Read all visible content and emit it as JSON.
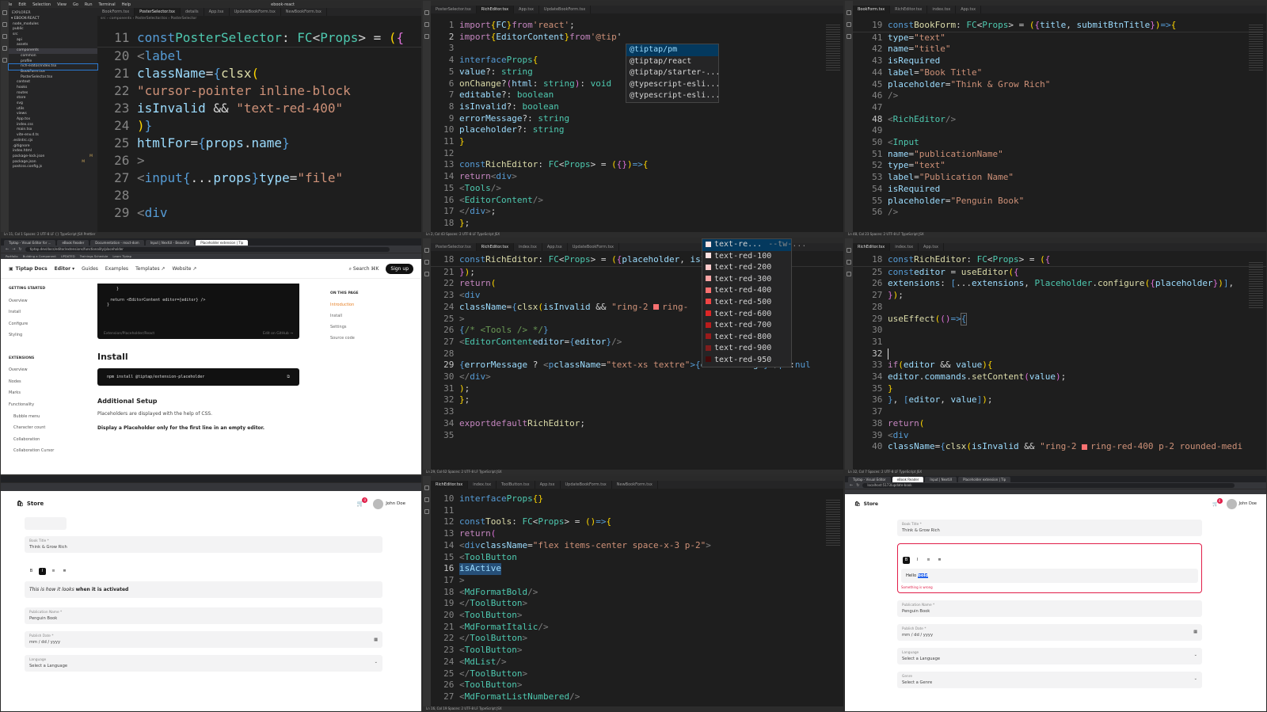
{
  "p1": {
    "menu": [
      "File",
      "Edit",
      "Selection",
      "View",
      "Go",
      "Run",
      "Terminal",
      "Help"
    ],
    "tabs": [
      "BookForm.tsx",
      "PosterSelector.tsx",
      "details",
      "App.tsx",
      "UpdateBookForm.tsx",
      "NewBookForm.tsx"
    ],
    "active_tab": "PosterSelector.tsx",
    "title": "ebook-react",
    "breadcrumb": "src › components › PosterSelector.tsx › PosterSelector",
    "explorer_title": "EXPLORER",
    "project": "EBOOK-REACT",
    "tree": [
      {
        "label": "node_modules",
        "depth": 1
      },
      {
        "label": "public",
        "depth": 1
      },
      {
        "label": "src",
        "depth": 1
      },
      {
        "label": "api",
        "depth": 2
      },
      {
        "label": "assets",
        "depth": 2
      },
      {
        "label": "components",
        "depth": 2,
        "sel": true
      },
      {
        "label": "common",
        "depth": 3
      },
      {
        "label": "profile",
        "depth": 3
      },
      {
        "label": "rich-editor/index.tsx",
        "depth": 3,
        "foc": true
      },
      {
        "label": "BookForm.tsx",
        "depth": 3
      },
      {
        "label": "PosterSelector.tsx",
        "depth": 3
      },
      {
        "label": "context",
        "depth": 2
      },
      {
        "label": "hooks",
        "depth": 2
      },
      {
        "label": "routes",
        "depth": 2
      },
      {
        "label": "store",
        "depth": 2
      },
      {
        "label": "svg",
        "depth": 2
      },
      {
        "label": "utils",
        "depth": 2
      },
      {
        "label": "views",
        "depth": 2
      },
      {
        "label": "App.tsx",
        "depth": 2
      },
      {
        "label": "index.css",
        "depth": 2
      },
      {
        "label": "main.tsx",
        "depth": 2
      },
      {
        "label": "vite-env.d.ts",
        "depth": 2
      },
      {
        "label": ".eslintrc.cjs",
        "depth": 1
      },
      {
        "label": ".gitignore",
        "depth": 1
      },
      {
        "label": "index.html",
        "depth": 1
      },
      {
        "label": "package-lock.json",
        "depth": 1,
        "m": "M"
      },
      {
        "label": "package.json",
        "depth": 1,
        "m": "M"
      },
      {
        "label": "postcss.config.js",
        "depth": 1
      }
    ],
    "status": "Ln 11, Col 1   Spaces: 2   UTF-8   LF   {} TypeScript JSX   Prettier"
  },
  "p2": {
    "tabs": [
      "PosterSelector.tsx",
      "RichEditor.tsx",
      "App.tsx",
      "UpdateBookForm.tsx"
    ],
    "active_tab": "RichEditor.tsx",
    "suggestions": [
      {
        "label": "@tiptap/pm"
      },
      {
        "label": "@tiptap/react"
      },
      {
        "label": "@tiptap/starter-..."
      },
      {
        "label": "@typescript-esli..."
      },
      {
        "label": "@typescript-esli..."
      }
    ],
    "status": "Ln 2, Col 43   Spaces: 2   UTF-8   LF   TypeScript JSX"
  },
  "p3": {
    "tabs": [
      "BookForm.tsx",
      "RichEditor.tsx",
      "index.tsx",
      "App.tsx"
    ],
    "active_tab": "BookForm.tsx",
    "status": "Ln 48, Col 23   Spaces: 2   UTF-8   LF   TypeScript JSX"
  },
  "p4": {
    "tabs": [
      "Tiptap - Visual Editor for ...",
      "eBook Reader",
      "Documentation - react-dom",
      "Input | NextUI - Beautiful",
      "Placeholder extension | Tip"
    ],
    "url": "tiptap.dev/docs/editor/extensions/functionality/placeholder",
    "bookmarks": [
      "Portfolio",
      "Building a Component",
      "UPDATED",
      "Trainings Schedule",
      "Learn Tiptap"
    ],
    "brand": "Tiptap Docs",
    "nav": [
      "Editor ▾",
      "Guides",
      "Examples",
      "Templates ↗",
      "Website ↗"
    ],
    "search": "Search  ⌘K",
    "signup": "Sign up",
    "sidebar": [
      {
        "label": "GETTING STARTED",
        "h": true
      },
      {
        "label": "Overview"
      },
      {
        "label": "Install"
      },
      {
        "label": "Configure"
      },
      {
        "label": "Styling"
      },
      {
        "label": ""
      },
      {
        "label": "EXTENSIONS",
        "h": true
      },
      {
        "label": "Overview"
      },
      {
        "label": "Nodes"
      },
      {
        "label": "Marks"
      },
      {
        "label": "Functionality"
      },
      {
        "label": "Bubble menu",
        "sub": true
      },
      {
        "label": "Character count",
        "sub": true
      },
      {
        "label": "Collaboration",
        "sub": true
      },
      {
        "label": "Collaboration Cursor",
        "sub": true
      }
    ],
    "snippet_brace": "}",
    "snippet_return": "return <EditorContent editor={editor} />",
    "snippet_close": "}",
    "snippet_source": "Extension/Placeholder/React",
    "snippet_edit": "Edit on GitHub →",
    "install_heading": "Install",
    "install_cmd": "npm install @tiptap/extension-placeholder",
    "setup_heading": "Additional Setup",
    "setup_text": "Placeholders are displayed with the help of CSS.",
    "setup_bold": "Display a Placeholder only for the first line in an empty editor.",
    "on_this_page": "ON THIS PAGE",
    "toc": [
      "Introduction",
      "Install",
      "Settings",
      "Source code"
    ]
  },
  "p5": {
    "tabs": [
      "PosterSelector.tsx",
      "RichEditor.tsx",
      "index.tsx",
      "App.tsx",
      "UpdateBookForm.tsx"
    ],
    "active_tab": "RichEditor.tsx",
    "colors": [
      {
        "label": "text-re...",
        "swatch": "#fee2e2",
        "extra": "--tw-..."
      },
      {
        "label": "text-red-100",
        "swatch": "#fee2e2"
      },
      {
        "label": "text-red-200",
        "swatch": "#fecaca"
      },
      {
        "label": "text-red-300",
        "swatch": "#fca5a5"
      },
      {
        "label": "text-red-400",
        "swatch": "#f87171"
      },
      {
        "label": "text-red-500",
        "swatch": "#ef4444"
      },
      {
        "label": "text-red-600",
        "swatch": "#dc2626"
      },
      {
        "label": "text-red-700",
        "swatch": "#b91c1c"
      },
      {
        "label": "text-red-800",
        "swatch": "#991b1b"
      },
      {
        "label": "text-red-900",
        "swatch": "#7f1d1d"
      },
      {
        "label": "text-red-950",
        "swatch": "#450a0a"
      }
    ],
    "status": "Ln 29, Col 62   Spaces: 2   UTF-8   LF   TypeScript JSX"
  },
  "p6": {
    "tabs": [
      "RichEditor.tsx",
      "index.tsx",
      "App.tsx"
    ],
    "status": "Ln 32, Col 7   Spaces: 2   UTF-8   LF   TypeScript JSX"
  },
  "p7": {
    "store_title": "Store",
    "cart_count": "0",
    "user": "John Doe",
    "book_title_label": "Book Title *",
    "book_title_value": "Think & Grow Rich",
    "toolbar": [
      "B",
      "I",
      "≡",
      "≣"
    ],
    "editor_italic": "This is how it looks",
    "editor_bold": "when it is activated",
    "publication_label": "Publication Name *",
    "publication_value": "Penguin Book",
    "publish_label": "Publish Date *",
    "publish_value": "mm / dd / yyyy",
    "language_label": "Language",
    "language_value": "Select a Language"
  },
  "p8": {
    "tabs": [
      "RichEditor.tsx",
      "index.tsx",
      "ToolButton.tsx",
      "App.tsx",
      "UpdateBookForm.tsx",
      "NewBookForm.tsx"
    ],
    "active_tab": "RichEditor.tsx",
    "status": "Ln 16, Col 19   Spaces: 2   UTF-8   LF   TypeScript JSX"
  },
  "p9": {
    "tabs": [
      "Tiptap - Visual Editor",
      "eBook Reader",
      "Input | NextUI",
      "Placeholder extension | Tip"
    ],
    "url": "localhost:5173/update-book",
    "store_title": "Store",
    "cart_count": "0",
    "user": "John Doe",
    "book_title_label": "Book Title *",
    "book_title_value": "Think & Grow Rich",
    "toolbar": [
      "B",
      "I",
      "≡",
      "≣"
    ],
    "editor_text": "Hello",
    "editor_selected": "bold",
    "editor_error": "Something is wrong",
    "publication_label": "Publication Name *",
    "publication_value": "Penguin Book",
    "publish_label": "Publish Date *",
    "publish_value": "mm / dd / yyyy",
    "language_label": "Language",
    "language_value": "Select a Language",
    "genre_label": "Genre",
    "genre_value": "Select a Genre"
  }
}
